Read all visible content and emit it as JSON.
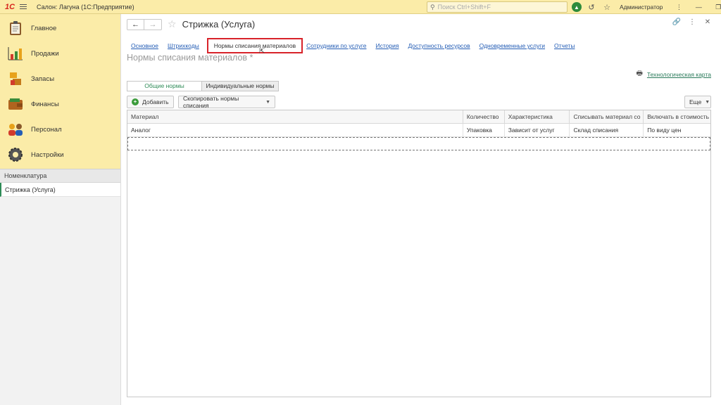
{
  "topbar": {
    "logo": "1С",
    "app_title": "Салон: Лагуна  (1С:Предприятие)",
    "search_placeholder": "Поиск Ctrl+Shift+F",
    "user": "Администратор"
  },
  "sidebar": {
    "sections": [
      {
        "label": "Главное",
        "icon": "clipboard-icon"
      },
      {
        "label": "Продажи",
        "icon": "chart-icon"
      },
      {
        "label": "Запасы",
        "icon": "stock-icon"
      },
      {
        "label": "Финансы",
        "icon": "wallet-icon"
      },
      {
        "label": "Персонал",
        "icon": "people-icon"
      },
      {
        "label": "Настройки",
        "icon": "gear-icon"
      }
    ],
    "nav_header": "Номенклатура",
    "nav_item": "Стрижка (Услуга)"
  },
  "form": {
    "title": "Стрижка (Услуга)",
    "tabs": [
      "Основное",
      "Штрихкоды",
      "Нормы списания материалов",
      "Сотрудники по услуге",
      "История",
      "Доступность ресурсов",
      "Одновременные услуги",
      "Отчеты"
    ],
    "active_tab": "Нормы списания материалов",
    "subtitle": "Нормы списания материалов *",
    "tech_card_link": "Технологическая карта",
    "switcher": {
      "common": "Общие нормы",
      "individual": "Индивидуальные нормы"
    },
    "toolbar": {
      "add": "Добавить",
      "copy": "Скопировать нормы списания",
      "more": "Еще"
    }
  },
  "table": {
    "columns": [
      "Материал",
      "Количество",
      "Характеристика",
      "Списывать материал со",
      "Включать в стоимость"
    ],
    "rows": [
      [
        "Аналог",
        "Упаковка",
        "Зависит от услуг",
        "Склад списания",
        "По виду цен"
      ]
    ]
  },
  "colors": {
    "accent_yellow": "#fbeca8",
    "highlight_red": "#d8232a",
    "link_blue": "#245db5",
    "green": "#2e8b57"
  }
}
